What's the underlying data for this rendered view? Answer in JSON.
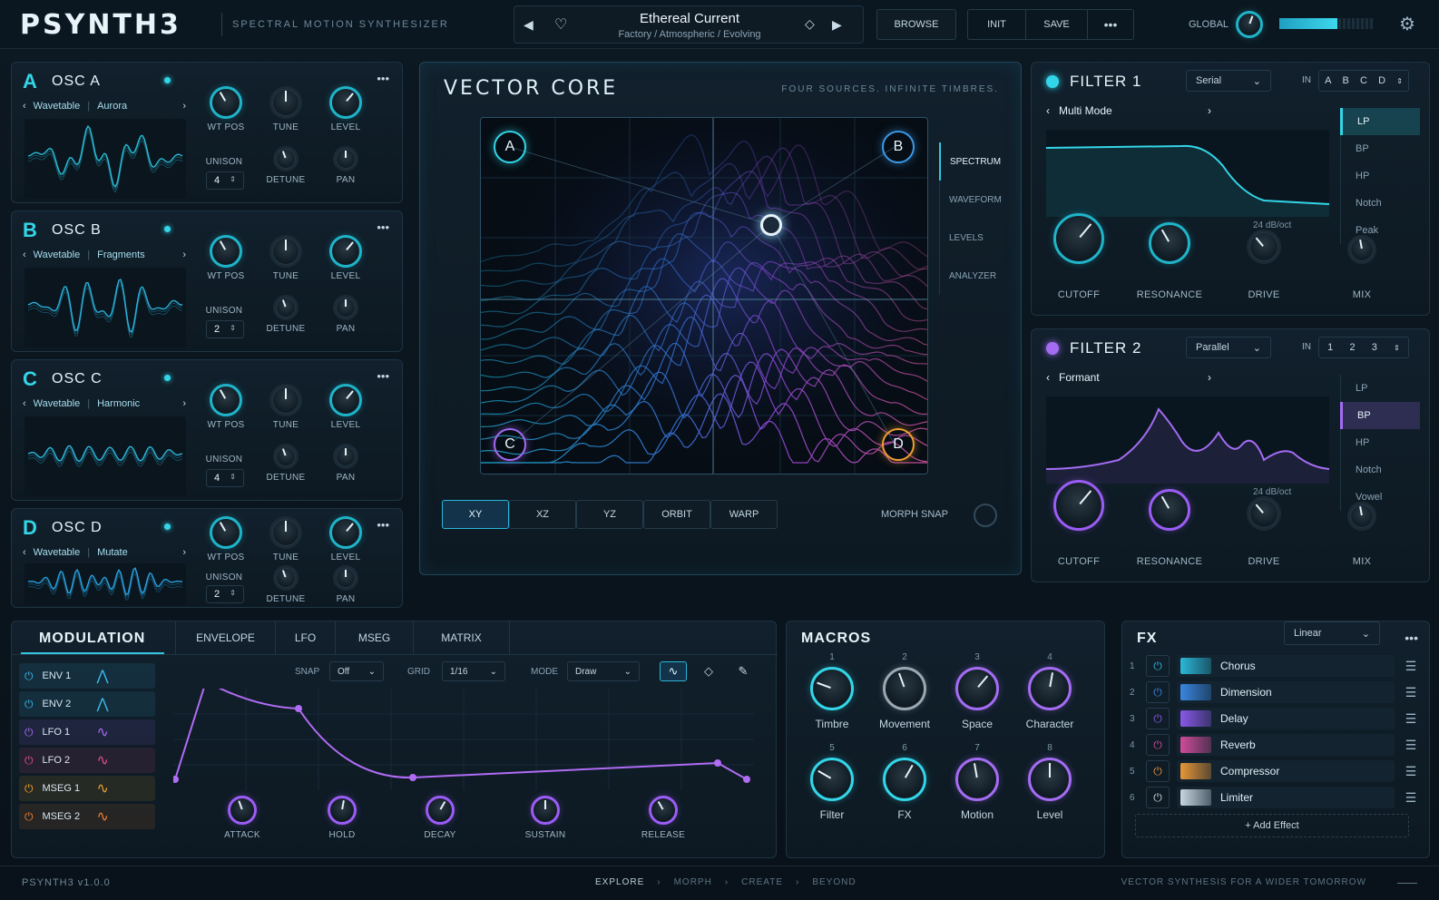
{
  "header": {
    "logo": "PSYNTH3",
    "subtitle": "SPECTRAL MOTION SYNTHESIZER",
    "preset_name": "Ethereal Current",
    "preset_path": "Factory  /  Atmospheric  /  Evolving",
    "browse": "BROWSE",
    "init": "INIT",
    "save": "SAVE",
    "global": "GLOBAL"
  },
  "oscillators": [
    {
      "letter": "A",
      "name": "OSC A",
      "wt": "Wavetable",
      "wt_name": "Aurora",
      "unison": "4",
      "color": "#33d6e8"
    },
    {
      "letter": "B",
      "name": "OSC B",
      "wt": "Wavetable",
      "wt_name": "Fragments",
      "unison": "2",
      "color": "#33d6e8"
    },
    {
      "letter": "C",
      "name": "OSC C",
      "wt": "Wavetable",
      "wt_name": "Harmonic",
      "unison": "4",
      "color": "#33d6e8"
    },
    {
      "letter": "D",
      "name": "OSC D",
      "wt": "Wavetable",
      "wt_name": "Mutate",
      "unison": "2",
      "color": "#33d6e8"
    }
  ],
  "osc_labels": {
    "wt_pos": "WT POS",
    "tune": "TUNE",
    "level": "LEVEL",
    "unison": "UNISON",
    "detune": "DETUNE",
    "pan": "PAN"
  },
  "vector": {
    "title": "VECTOR CORE",
    "tagline": "FOUR SOURCES. INFINITE TIMBRES.",
    "corners": [
      "A",
      "B",
      "C",
      "D"
    ],
    "side_tabs": [
      "SPECTRUM",
      "WAVEFORM",
      "LEVELS",
      "ANALYZER"
    ],
    "modes": [
      "XY",
      "XZ",
      "YZ",
      "ORBIT",
      "WARP"
    ],
    "morph_snap": "MORPH SNAP"
  },
  "filter1": {
    "title": "FILTER 1",
    "routing": "Serial",
    "in": "IN",
    "inputs": [
      "A",
      "B",
      "C",
      "D"
    ],
    "mode": "Multi Mode",
    "types": [
      "LP",
      "BP",
      "HP",
      "Notch",
      "Peak"
    ],
    "slope": "24 dB/oct",
    "knobs": [
      "CUTOFF",
      "RESONANCE",
      "DRIVE",
      "MIX"
    ]
  },
  "filter2": {
    "title": "FILTER 2",
    "routing": "Parallel",
    "in": "IN",
    "inputs": [
      "1",
      "2",
      "3"
    ],
    "mode": "Formant",
    "types": [
      "LP",
      "BP",
      "HP",
      "Notch",
      "Vowel"
    ],
    "slope": "24 dB/oct",
    "knobs": [
      "CUTOFF",
      "RESONANCE",
      "DRIVE",
      "MIX"
    ]
  },
  "modulation": {
    "title": "MODULATION",
    "tabs": [
      "ENVELOPE",
      "LFO",
      "MSEG",
      "MATRIX"
    ],
    "sources": [
      {
        "name": "ENV 1",
        "color": "#3ab8e8"
      },
      {
        "name": "ENV 2",
        "color": "#3ab8e8"
      },
      {
        "name": "LFO 1",
        "color": "#a46cf3"
      },
      {
        "name": "LFO 2",
        "color": "#e0508a"
      },
      {
        "name": "MSEG 1",
        "color": "#f0a030"
      },
      {
        "name": "MSEG 2",
        "color": "#f08030"
      }
    ],
    "snap_label": "SNAP",
    "snap": "Off",
    "grid_label": "GRID",
    "grid": "1/16",
    "mode_label": "MODE",
    "mode": "Draw",
    "knobs": [
      "ATTACK",
      "HOLD",
      "DECAY",
      "SUSTAIN",
      "RELEASE"
    ]
  },
  "macros": {
    "title": "MACROS",
    "items": [
      {
        "n": "1",
        "name": "Timbre"
      },
      {
        "n": "2",
        "name": "Movement"
      },
      {
        "n": "3",
        "name": "Space"
      },
      {
        "n": "4",
        "name": "Character"
      },
      {
        "n": "5",
        "name": "Filter"
      },
      {
        "n": "6",
        "name": "FX"
      },
      {
        "n": "7",
        "name": "Motion"
      },
      {
        "n": "8",
        "name": "Level"
      }
    ]
  },
  "fx": {
    "title": "FX",
    "routing": "Linear",
    "add": "+  Add Effect",
    "items": [
      {
        "n": "1",
        "name": "Chorus",
        "color": "#2bb8d8"
      },
      {
        "n": "2",
        "name": "Dimension",
        "color": "#3a86e0"
      },
      {
        "n": "3",
        "name": "Delay",
        "color": "#8a58e8"
      },
      {
        "n": "4",
        "name": "Reverb",
        "color": "#d04c9a"
      },
      {
        "n": "5",
        "name": "Compressor",
        "color": "#e89638"
      },
      {
        "n": "6",
        "name": "Limiter",
        "color": "#c8d6e0"
      }
    ]
  },
  "footer": {
    "version": "PSYNTH3  v1.0.0",
    "steps": [
      "EXPLORE",
      "MORPH",
      "CREATE",
      "BEYOND"
    ],
    "tagline": "VECTOR SYNTHESIS FOR A WIDER TOMORROW"
  }
}
